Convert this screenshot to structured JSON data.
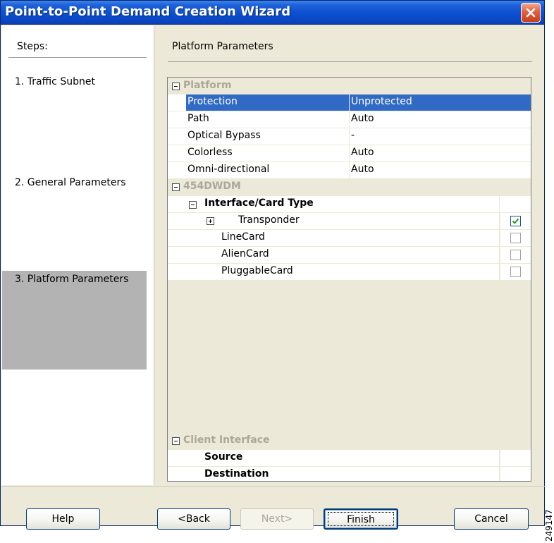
{
  "window": {
    "title": "Point-to-Point Demand Creation Wizard"
  },
  "steps": {
    "header": "Steps:",
    "items": [
      {
        "label": "1. Traffic Subnet"
      },
      {
        "label": "2. General Parameters"
      },
      {
        "label": "3. Platform Parameters",
        "active": true
      }
    ]
  },
  "content": {
    "header": "Platform Parameters"
  },
  "grid": {
    "platform": {
      "label": "Platform",
      "rows": [
        {
          "name": "Protection",
          "value": "Unprotected",
          "selected": true
        },
        {
          "name": "Path",
          "value": "Auto"
        },
        {
          "name": "Optical Bypass",
          "value": "-"
        },
        {
          "name": "Colorless",
          "value": "Auto"
        },
        {
          "name": "Omni-directional",
          "value": "Auto"
        }
      ]
    },
    "dwdm": {
      "label": "454DWDM",
      "interface_label": "Interface/Card Type",
      "cards": [
        {
          "name": "Transponder",
          "checked": true,
          "expandable": true
        },
        {
          "name": "LineCard",
          "checked": false
        },
        {
          "name": "AlienCard",
          "checked": false
        },
        {
          "name": "PluggableCard",
          "checked": false
        }
      ]
    },
    "client": {
      "label": "Client Interface",
      "rows": [
        {
          "name": "Source"
        },
        {
          "name": "Destination"
        }
      ]
    }
  },
  "buttons": {
    "help": "Help",
    "back": "<Back",
    "next": "Next>",
    "finish": "Finish",
    "cancel": "Cancel"
  },
  "side_code": "249147",
  "colors": {
    "titlebar": "#0b4fd0",
    "selection": "#316ac5",
    "active_step": "#b3b3b3",
    "dialog": "#ece9d8"
  }
}
